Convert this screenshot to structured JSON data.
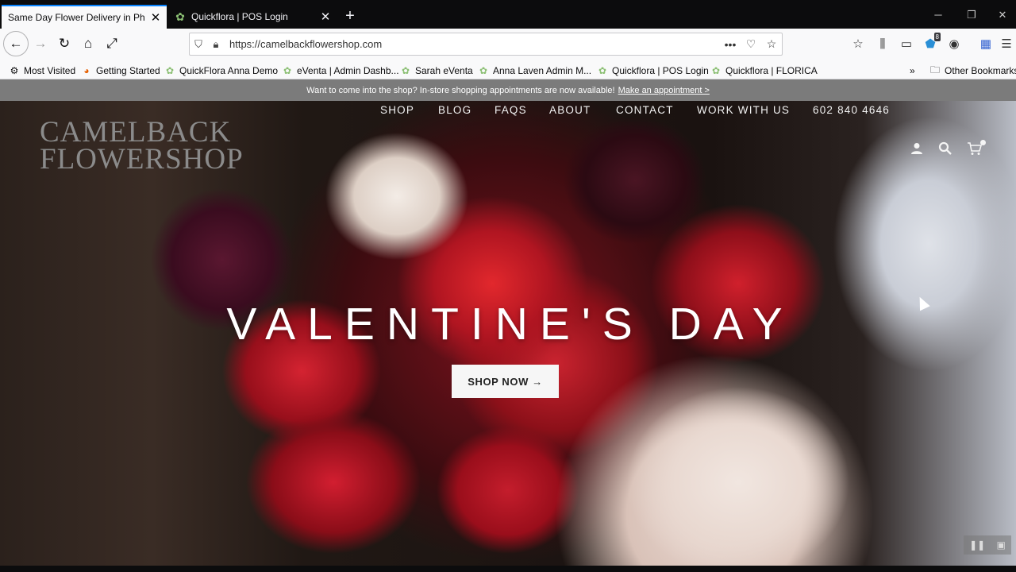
{
  "browser": {
    "tabs": [
      {
        "title": "Same Day Flower Delivery in Ph",
        "active": true,
        "favicon": "site-icon"
      },
      {
        "title": "Quickflora | POS Login",
        "active": false,
        "favicon": "clover-icon"
      }
    ],
    "url": "https://camelbackflowershop.com",
    "extension_badge": "8",
    "bookmarks": [
      {
        "label": "Most Visited",
        "icon": "gear-icon"
      },
      {
        "label": "Getting Started",
        "icon": "firefox-icon"
      },
      {
        "label": "QuickFlora Anna Demo",
        "icon": "clover-icon"
      },
      {
        "label": "eVenta | Admin Dashb...",
        "icon": "clover-icon"
      },
      {
        "label": "Sarah eVenta",
        "icon": "clover-icon"
      },
      {
        "label": "Anna Laven Admin M...",
        "icon": "clover-icon"
      },
      {
        "label": "Quickflora | POS Login",
        "icon": "clover-icon"
      },
      {
        "label": "Quickflora | FLORICA",
        "icon": "clover-icon"
      }
    ],
    "other_bookmarks": "Other Bookmarks"
  },
  "site": {
    "announcement": {
      "text": "Want to come into the shop? In-store shopping appointments are now available!",
      "link": "Make an appointment >"
    },
    "logo": {
      "line1": "CAMELBACK",
      "line2": "FLOWERSHOP"
    },
    "nav": {
      "shop": "SHOP",
      "blog": "BLOG",
      "faqs": "FAQS",
      "about": "ABOUT",
      "contact": "CONTACT",
      "work": "WORK WITH US",
      "phone": "602 840 4646"
    },
    "hero": {
      "headline": "VALENTINE'S DAY",
      "cta": "SHOP NOW →"
    }
  }
}
